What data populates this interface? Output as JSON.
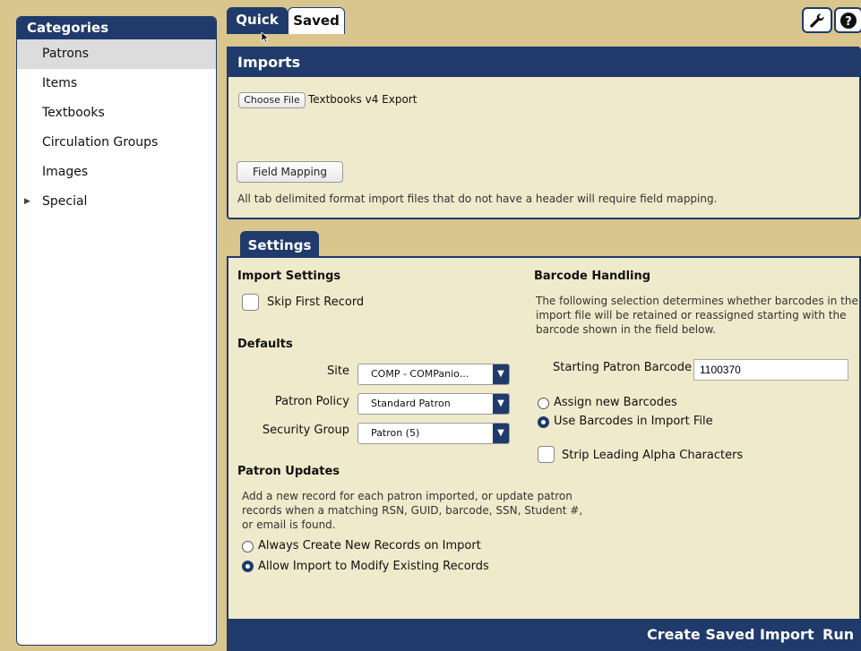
{
  "sidebar": {
    "title": "Categories",
    "items": [
      {
        "label": "Patrons"
      },
      {
        "label": "Items"
      },
      {
        "label": "Textbooks"
      },
      {
        "label": "Circulation Groups"
      },
      {
        "label": "Images"
      },
      {
        "label": "Special"
      }
    ],
    "selected": "Patrons"
  },
  "tabs": {
    "quick": "Quick",
    "saved": "Saved"
  },
  "toolbar_icons": [
    "wrench-icon",
    "help-icon"
  ],
  "imports": {
    "title": "Imports",
    "choose_file_label": "Choose File",
    "file_name": "Textbooks v4 Export",
    "field_mapping_label": "Field Mapping",
    "note": "All tab delimited format import files that do not have a header will require field mapping."
  },
  "settings": {
    "tab_label": "Settings",
    "import_settings": {
      "heading": "Import Settings",
      "skip_first_record": "Skip First Record"
    },
    "defaults": {
      "heading": "Defaults",
      "site_label": "Site",
      "site_value": "COMP - COMPanio...",
      "patron_policy_label": "Patron Policy",
      "patron_policy_value": "Standard Patron",
      "security_group_label": "Security Group",
      "security_group_value": "Patron (5)"
    },
    "patron_updates": {
      "heading": "Patron Updates",
      "desc": "Add a new record for each patron imported, or update patron records when a matching RSN, GUID, barcode, SSN, Student #, or email is found.",
      "option_always_new": "Always Create New Records on Import",
      "option_allow_modify": "Allow Import to Modify Existing Records",
      "selected": "Allow Import to Modify Existing Records"
    },
    "barcode_handling": {
      "heading": "Barcode Handling",
      "desc": "The following selection determines whether barcodes in the import file will be retained or reassigned starting with the barcode shown in the field below.",
      "starting_label": "Starting Patron Barcode",
      "starting_value": "1100370",
      "option_assign_new": "Assign new Barcodes",
      "option_use_import": "Use Barcodes in Import File",
      "selected": "Use Barcodes in Import File",
      "strip_alpha": "Strip Leading Alpha Characters"
    }
  },
  "footer": {
    "create_saved_import": "Create Saved Import",
    "run": "Run"
  },
  "colors": {
    "navy": "#1f3a6b",
    "background": "#d9c68c",
    "panel": "#efeacb"
  }
}
